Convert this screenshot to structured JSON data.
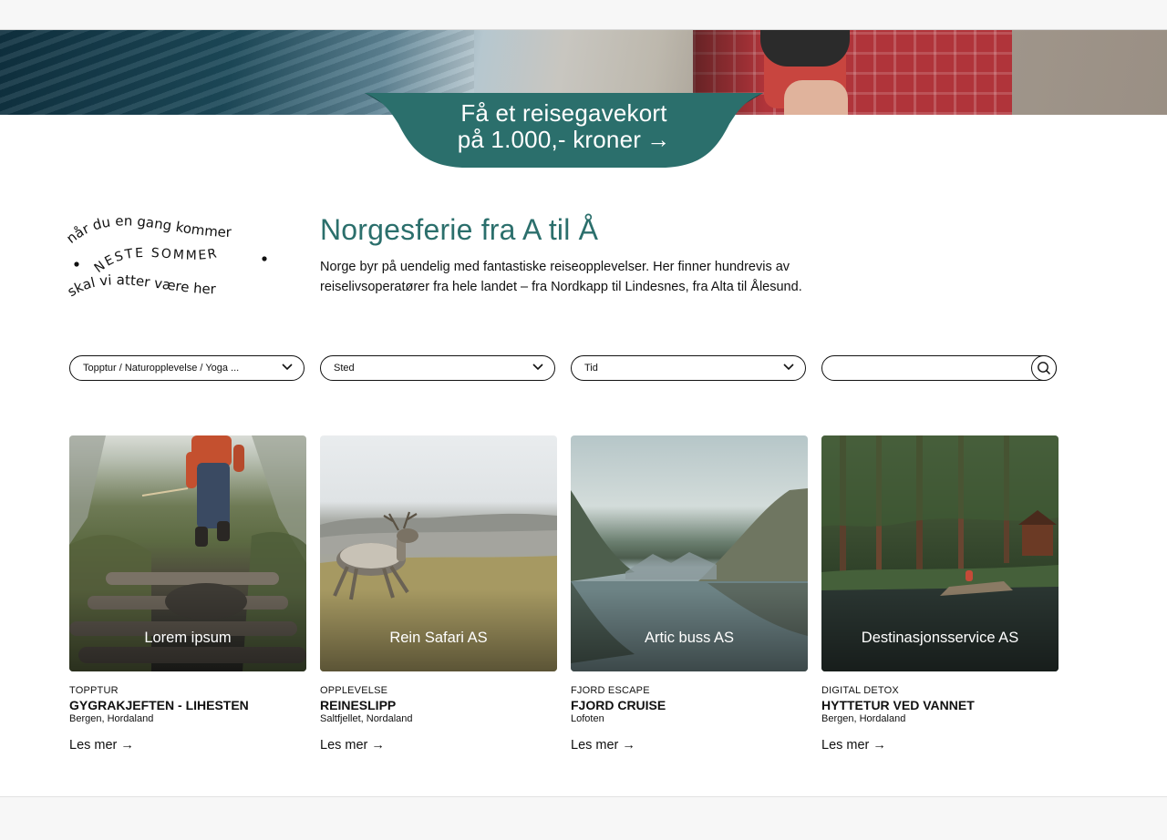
{
  "promo": {
    "line1": "Få et reisegavekort",
    "line2": "på 1.000,- kroner",
    "arrow": "→",
    "ribbon_color": "#2b6f6c"
  },
  "stamp": {
    "arc_top": "når du en gang kommer",
    "middle": "NESTE SOMMER",
    "arc_bottom": "skal vi atter være her"
  },
  "intro": {
    "title": "Norgesferie fra A til Å",
    "body": "Norge byr på uendelig med fantastiske reiseopplevelser. Her finner hundrevis av reiselivsoperatører fra hele landet – fra Nordkapp til Lindesnes, fra Alta til Ålesund."
  },
  "filters": {
    "category": "Topptur / Naturopplevelse / Yoga ...",
    "place": "Sted",
    "time": "Tid",
    "search_value": ""
  },
  "cards": [
    {
      "image_label": "Lorem ipsum",
      "category": "TOPPTUR",
      "title": "GYGRAKJEFTEN - LIHESTEN",
      "location": "Bergen, Hordaland",
      "more": "Les mer →"
    },
    {
      "image_label": "Rein Safari AS",
      "category": "OPPLEVELSE",
      "title": "REINESLIPP",
      "location": "Saltfjellet, Nordaland",
      "more": "Les mer →"
    },
    {
      "image_label": "Artic buss AS",
      "category": "FJORD ESCAPE",
      "title": "FJORD CRUISE",
      "location": "Lofoten",
      "more": "Les mer →"
    },
    {
      "image_label": "Destinasjonsservice AS",
      "category": "DIGITAL DETOX",
      "title": "HYTTETUR VED VANNET",
      "location": "Bergen, Hordaland",
      "more": "Les mer →"
    }
  ],
  "colors": {
    "accent": "#2b6f6c",
    "text": "#111111"
  }
}
